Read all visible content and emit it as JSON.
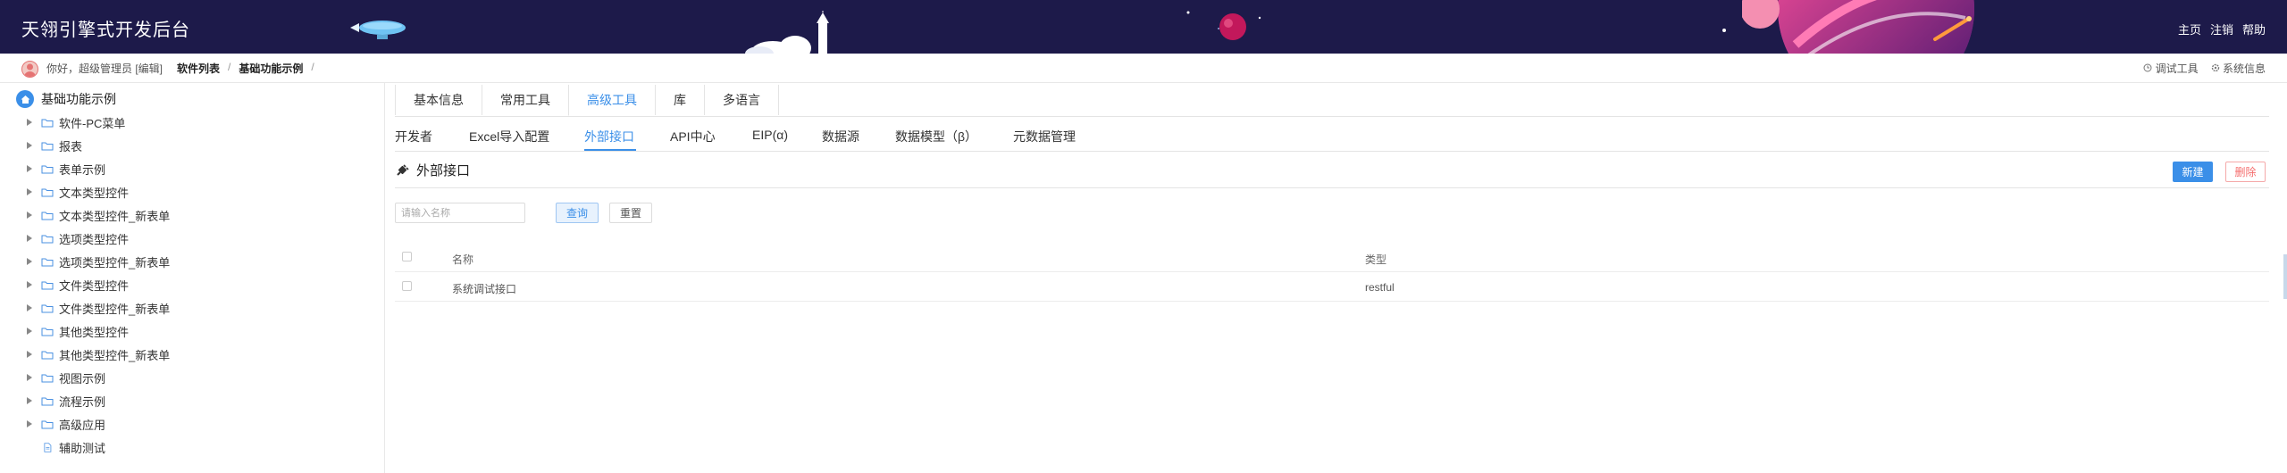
{
  "header": {
    "title": "天翎引擎式开发后台",
    "nav": [
      "主页",
      "注销",
      "帮助"
    ]
  },
  "topbar": {
    "greeting": "你好，超级管理员 [编辑]",
    "breadcrumbs": [
      "软件列表",
      "基础功能示例"
    ],
    "separator": "/",
    "tools": [
      "调试工具",
      "系统信息"
    ]
  },
  "sidebar": {
    "root": "基础功能示例",
    "items": [
      {
        "label": "软件-PC菜单",
        "icon": "folder-icon"
      },
      {
        "label": "报表",
        "icon": "folder-icon"
      },
      {
        "label": "表单示例",
        "icon": "folder-icon"
      },
      {
        "label": "文本类型控件",
        "icon": "folder-icon"
      },
      {
        "label": "文本类型控件_新表单",
        "icon": "folder-icon"
      },
      {
        "label": "选项类型控件",
        "icon": "folder-icon"
      },
      {
        "label": "选项类型控件_新表单",
        "icon": "folder-icon"
      },
      {
        "label": "文件类型控件",
        "icon": "folder-icon"
      },
      {
        "label": "文件类型控件_新表单",
        "icon": "folder-icon"
      },
      {
        "label": "其他类型控件",
        "icon": "folder-icon"
      },
      {
        "label": "其他类型控件_新表单",
        "icon": "folder-icon"
      },
      {
        "label": "视图示例",
        "icon": "folder-icon"
      },
      {
        "label": "流程示例",
        "icon": "folder-icon"
      },
      {
        "label": "高级应用",
        "icon": "folder-icon"
      },
      {
        "label": "辅助测试",
        "icon": "file-icon"
      }
    ]
  },
  "tabs_primary": [
    "基本信息",
    "常用工具",
    "高级工具",
    "库",
    "多语言"
  ],
  "tabs_primary_active": "高级工具",
  "tabs_secondary": [
    "开发者",
    "Excel导入配置",
    "外部接口",
    "API中心",
    "EIP(α)",
    "数据源",
    "数据模型（β）",
    "元数据管理"
  ],
  "tabs_secondary_active": "外部接口",
  "panel": {
    "title": "外部接口",
    "new_label": "新建",
    "delete_label": "删除",
    "search_placeholder": "请输入名称",
    "query_label": "查询",
    "reset_label": "重置"
  },
  "table": {
    "columns": [
      "名称",
      "类型"
    ],
    "rows": [
      {
        "name": "系统调试接口",
        "type": "restful"
      }
    ]
  },
  "colors": {
    "header_bg": "#1d1a4a",
    "accent": "#3b8fe8",
    "danger": "#f56c6c"
  }
}
